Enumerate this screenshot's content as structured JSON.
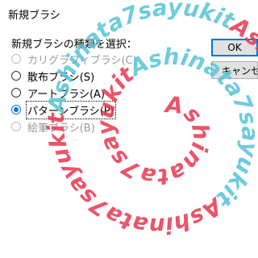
{
  "window": {
    "title": "新規ブラシ"
  },
  "prompt": "新規ブラシの種類を選択：",
  "options": [
    {
      "label": "カリグラフィブラシ(C)",
      "enabled": false,
      "selected": false
    },
    {
      "label": "散布ブラシ(S)",
      "enabled": true,
      "selected": false
    },
    {
      "label": "アートブラシ(A)",
      "enabled": true,
      "selected": false
    },
    {
      "label": "パターンブラシ(P)",
      "enabled": true,
      "selected": true
    },
    {
      "label": "絵筆ブラシ(B)",
      "enabled": false,
      "selected": false
    }
  ],
  "buttons": {
    "ok_label": "OK",
    "cancel_label": "キャンセル"
  },
  "watermark": {
    "text": "Ashinata7sayukitAshinata7sayukitAshinata7sayukitAshinata7sayukitAshinata7sayukit",
    "colors": [
      "#e8364f",
      "#56c3d6"
    ]
  }
}
